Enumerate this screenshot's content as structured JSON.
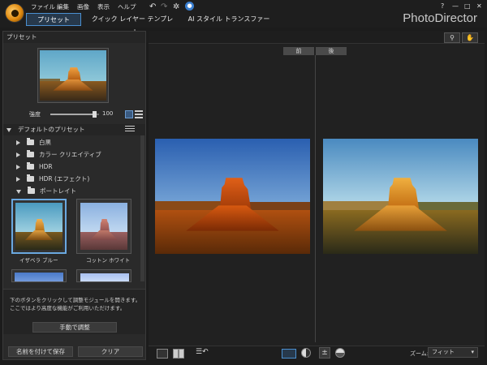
{
  "app": {
    "brand": "PhotoDirector"
  },
  "menu": [
    "ファイル",
    "編集",
    "画像",
    "表示",
    "ヘルプ"
  ],
  "toolbar_icons": [
    "undo-icon",
    "redo-icon",
    "settings-icon",
    "update-icon"
  ],
  "window_buttons": [
    "?",
    "—",
    "□",
    "✕"
  ],
  "tabs": [
    "プリセット",
    "クイック レイヤー テンプレート",
    "AI スタイル トランスファー"
  ],
  "left": {
    "header": "プリセット",
    "strength_label": "強度",
    "strength_value": "100",
    "strength_level": 0.9,
    "presets_header": "デフォルトのプリセット",
    "tree": [
      {
        "label": "白黒",
        "open": false
      },
      {
        "label": "カラー クリエイティブ",
        "open": false
      },
      {
        "label": "HDR",
        "open": false
      },
      {
        "label": "HDR (エフェクト)",
        "open": false
      },
      {
        "label": "ポートレイト",
        "open": true
      }
    ],
    "presets": [
      {
        "label": "イザベラ ブルー",
        "selected": true
      },
      {
        "label": "コットン ホワイト",
        "selected": false
      }
    ],
    "info_text": "下のボタンをクリックして調整モジュールを開きます。ここではより高度な機能がご利用いただけます。",
    "manual_button": "手動で調整",
    "save_button": "名前を付けて保存",
    "clear_button": "クリア"
  },
  "compare": {
    "before": "前",
    "after": "後"
  },
  "bottom": {
    "zoom_label": "ズーム:",
    "zoom_value": "フィット"
  },
  "colors": {
    "accent": "#4a8fd0",
    "panel": "#2a2a2a",
    "background": "#1c1c1c"
  }
}
